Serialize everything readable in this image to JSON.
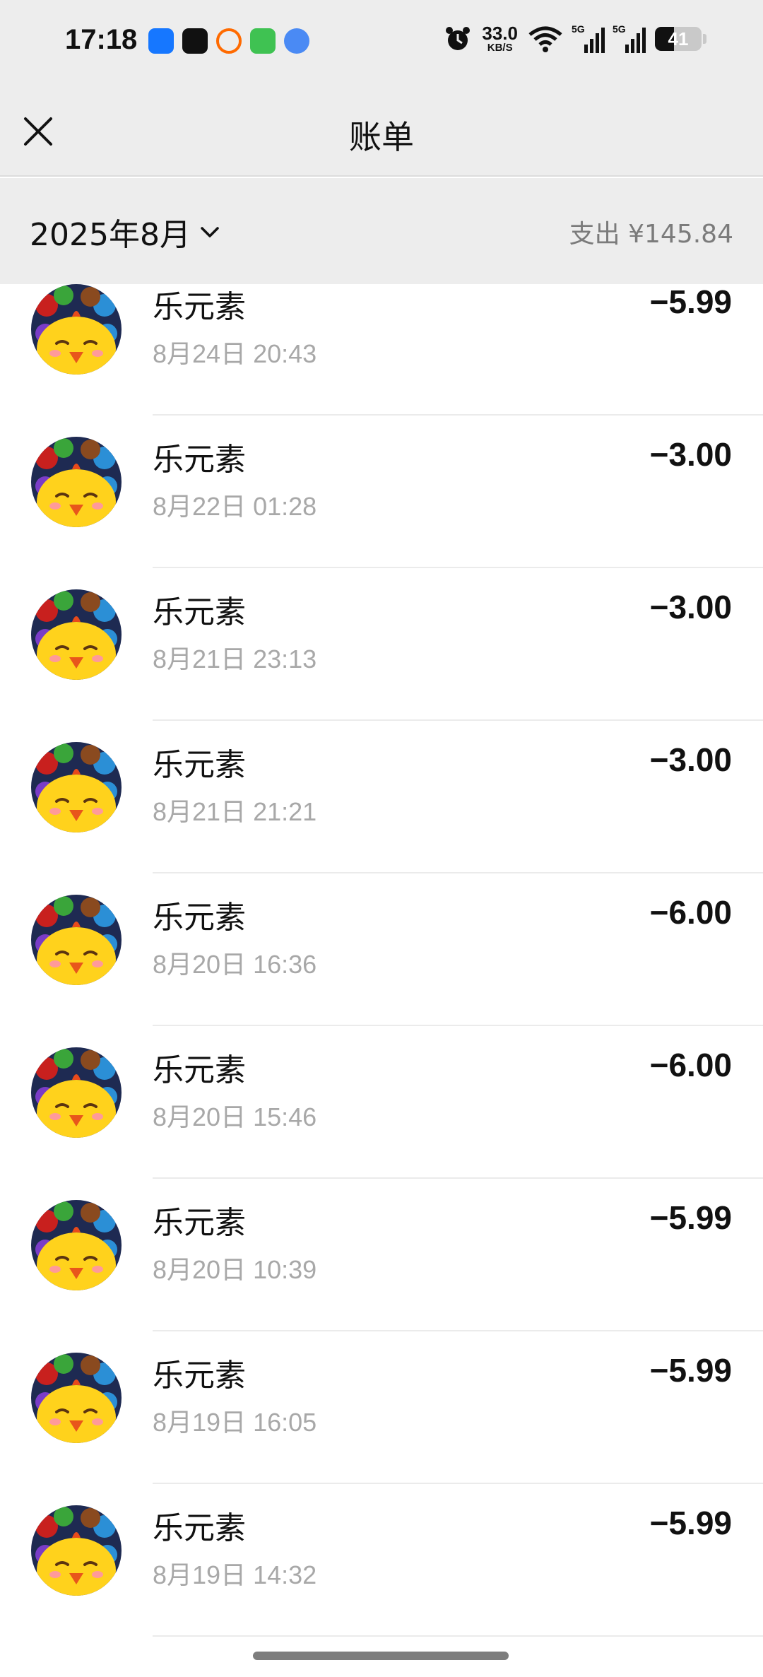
{
  "status_bar": {
    "time": "17:18",
    "net_speed_value": "33.0",
    "net_speed_unit": "KB/S",
    "signal_1_label": "5G",
    "signal_2_label": "5G",
    "battery_percent": "41",
    "battery_level": 0.41
  },
  "nav": {
    "title": "账单",
    "close_icon": "close-icon"
  },
  "month_bar": {
    "month_label": "2025年8月",
    "summary": "支出 ¥145.84"
  },
  "transactions": [
    {
      "merchant": "乐元素",
      "time": "8月24日 20:43",
      "amount": "−5.99"
    },
    {
      "merchant": "乐元素",
      "time": "8月22日 01:28",
      "amount": "−3.00"
    },
    {
      "merchant": "乐元素",
      "time": "8月21日 23:13",
      "amount": "−3.00"
    },
    {
      "merchant": "乐元素",
      "time": "8月21日 21:21",
      "amount": "−3.00"
    },
    {
      "merchant": "乐元素",
      "time": "8月20日 16:36",
      "amount": "−6.00"
    },
    {
      "merchant": "乐元素",
      "time": "8月20日 15:46",
      "amount": "−6.00"
    },
    {
      "merchant": "乐元素",
      "time": "8月20日 10:39",
      "amount": "−5.99"
    },
    {
      "merchant": "乐元素",
      "time": "8月19日 16:05",
      "amount": "−5.99"
    },
    {
      "merchant": "乐元素",
      "time": "8月19日 14:32",
      "amount": "−5.99"
    }
  ],
  "colors": {
    "header_bg": "#ededed",
    "secondary_text": "#a8a8a8",
    "summary_text": "#7b7b7b"
  }
}
